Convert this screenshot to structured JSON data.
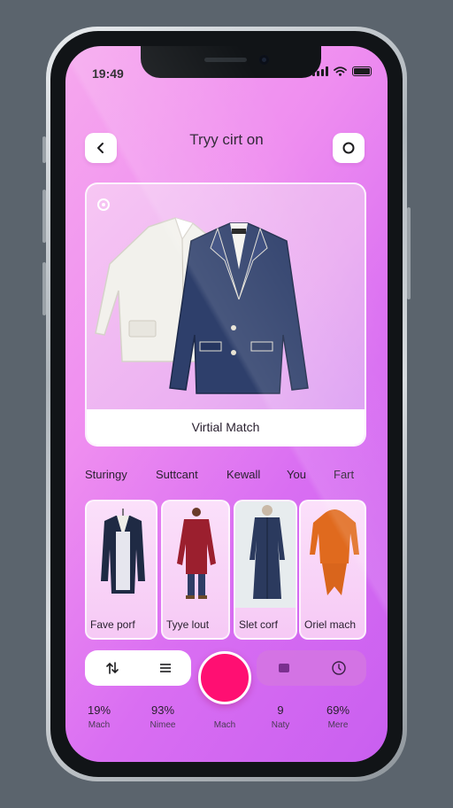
{
  "status_bar": {
    "time": "19:49"
  },
  "header": {
    "title": "Tryy cirt on",
    "back_icon": "chevron-left-icon",
    "action_icon": "circle-icon"
  },
  "hero": {
    "caption": "Virtial Match",
    "badge_icon": "badge-icon"
  },
  "filter_tabs": [
    {
      "label": "Sturingy"
    },
    {
      "label": "Suttcant"
    },
    {
      "label": "Kewall"
    },
    {
      "label": "You"
    },
    {
      "label": "Fart"
    }
  ],
  "outfits": [
    {
      "label": "Fave porf"
    },
    {
      "label": "Tyye lout"
    },
    {
      "label": "Slet corf"
    },
    {
      "label": "Oriel mach"
    }
  ],
  "controls": {
    "left_icons": [
      "upload-icon",
      "menu-icon"
    ],
    "right_icons": [
      "folder-icon",
      "clock-icon"
    ]
  },
  "stats": [
    {
      "value": "19%",
      "label": "Mach"
    },
    {
      "value": "93%",
      "label": "Nimee"
    },
    {
      "value": "",
      "label": "Mach"
    },
    {
      "value": "9",
      "label": "Naty"
    },
    {
      "value": "69%",
      "label": "Mere"
    }
  ],
  "colors": {
    "accent": "#ff0f72",
    "background_start": "#f6a8ee",
    "background_end": "#c95ff0",
    "text": "#2a2130"
  }
}
